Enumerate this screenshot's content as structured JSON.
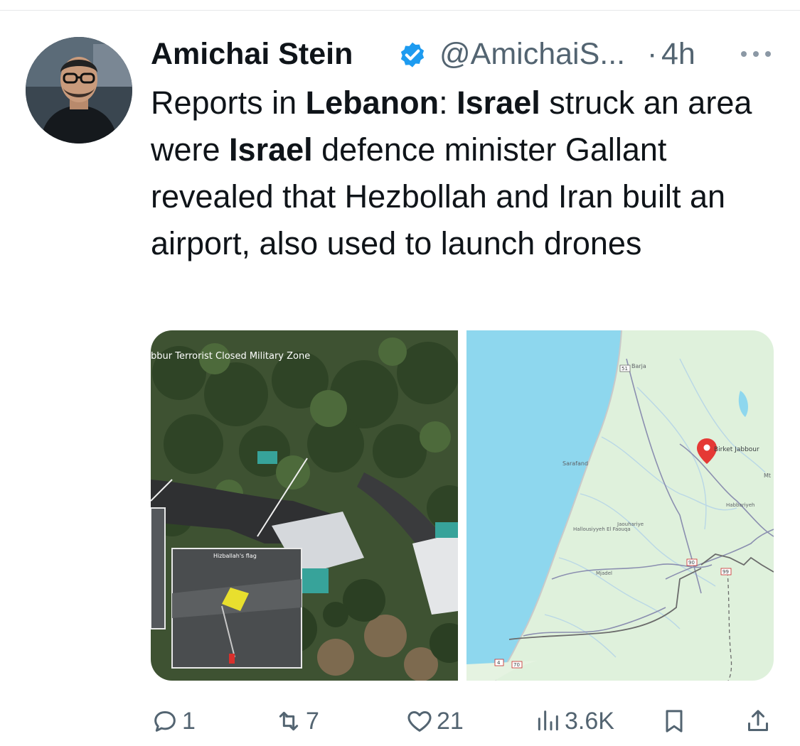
{
  "author": {
    "name": "Amichai Stein",
    "handle": "@AmichaiS...",
    "separator": "·",
    "time": "4h"
  },
  "tweet": {
    "parts": [
      {
        "text": "Reports in ",
        "bold": false
      },
      {
        "text": "Lebanon",
        "bold": true
      },
      {
        "text": ": ",
        "bold": false
      },
      {
        "text": "Israel",
        "bold": true
      },
      {
        "text": " struck an area were ",
        "bold": false
      },
      {
        "text": "Israel",
        "bold": true
      },
      {
        "text": " defence minister Gallant revealed that Hezbollah and Iran built an airport, also used to launch drones",
        "bold": false
      }
    ]
  },
  "media": {
    "photo": {
      "caption": "bbur Terrorist Closed Military Zone",
      "inset_label": "Hizballah's flag"
    },
    "map": {
      "pin_label": "Birket Jabbour",
      "places": [
        "Barja",
        "Sarafand",
        "Hallousiyyeh El Faouqa",
        "Jaouhariye",
        "Mjadel",
        "Habbariyeh",
        "Mt"
      ],
      "road_numbers": [
        "51",
        "90",
        "99",
        "4",
        "70"
      ]
    }
  },
  "actions": {
    "replies": "1",
    "reposts": "7",
    "likes": "21",
    "views": "3.6K"
  },
  "colors": {
    "verified": "#1d9bf0",
    "secondary_text": "#536471",
    "map_sea": "#8ed7ee",
    "map_land": "#dff1dc",
    "map_pin": "#e53935"
  }
}
